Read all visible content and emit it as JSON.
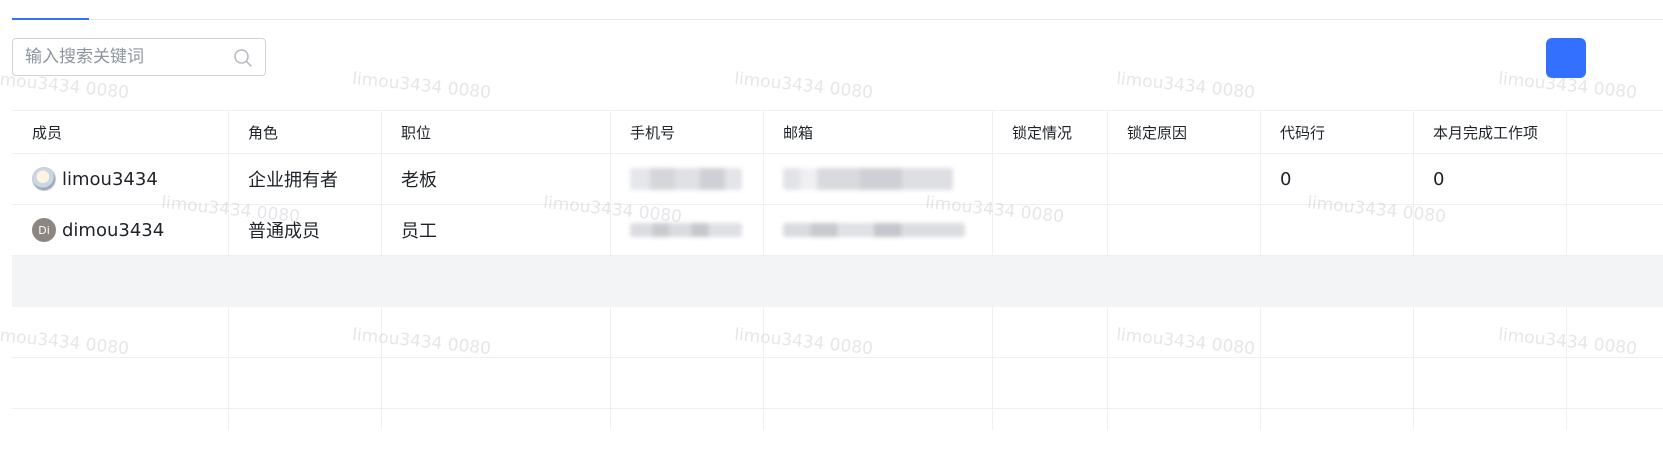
{
  "search": {
    "placeholder": "输入搜索关键词"
  },
  "table": {
    "columns": [
      "成员",
      "角色",
      "职位",
      "手机号",
      "邮箱",
      "锁定情况",
      "锁定原因",
      "代码行",
      "本月完成工作项"
    ],
    "rows": [
      {
        "member": "limou3434",
        "avatar_type": "image",
        "role": "企业拥有者",
        "position": "老板",
        "code_lines": "0",
        "work_items": "0"
      },
      {
        "member": "dimou3434",
        "avatar_initials": "Di",
        "role": "普通成员",
        "position": "员工",
        "code_lines": "",
        "work_items": ""
      }
    ]
  },
  "watermark": "limou3434 0080",
  "colors": {
    "accent": "#3370ff",
    "border": "#eff0f1",
    "row_hover": "#f3f4f6"
  }
}
